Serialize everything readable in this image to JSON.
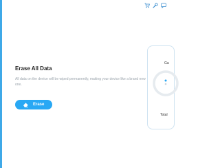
{
  "toolbar": {
    "cart_icon": "cart-icon",
    "wrench_icon": "wrench-icon",
    "chat_icon": "chat-icon"
  },
  "main": {
    "title": "Erase All Data",
    "description": "All data on the device will be wiped permanently, making your device like a brand new one.",
    "erase_button_label": "Erase",
    "erase_button_icon": "eraser-icon"
  },
  "device_panel": {
    "label_top": "Ga",
    "label_bottom": "Total"
  },
  "colors": {
    "accent": "#29a8f4",
    "left_bar": "#3fa9e8",
    "title_text": "#222222",
    "description_text": "#9aa3ab",
    "gauge_track": "#e6ebef"
  }
}
